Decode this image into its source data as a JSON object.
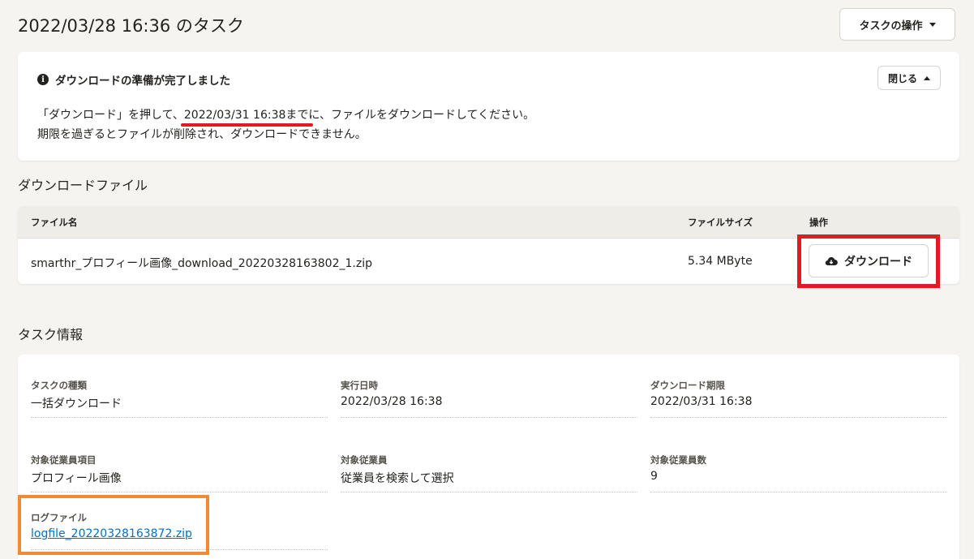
{
  "header": {
    "title": "2022/03/28 16:36 のタスク",
    "actions_label": "タスクの操作"
  },
  "notice": {
    "title": "ダウンロードの準備が完了しました",
    "close_label": "閉じる",
    "line1_prefix": "「ダウンロード」を押して、",
    "line1_deadline": "2022/03/31 16:38まで",
    "line1_suffix": "に、ファイルをダウンロードしてください。",
    "line2": "期限を過ぎるとファイルが削除され、ダウンロードできません。"
  },
  "download_section": {
    "title": "ダウンロードファイル",
    "columns": [
      "ファイル名",
      "ファイルサイズ",
      "操作"
    ],
    "rows": [
      {
        "filename": "smarthr_プロフィール画像_download_20220328163802_1.zip",
        "size": "5.34 MByte",
        "action_label": "ダウンロード"
      }
    ]
  },
  "task_info": {
    "title": "タスク情報",
    "fields": [
      {
        "label": "タスクの種類",
        "value": "一括ダウンロード"
      },
      {
        "label": "実行日時",
        "value": "2022/03/28 16:38"
      },
      {
        "label": "ダウンロード期限",
        "value": "2022/03/31 16:38"
      },
      {
        "label": "対象従業員項目",
        "value": "プロフィール画像"
      },
      {
        "label": "対象従業員",
        "value": "従業員を検索して選択"
      },
      {
        "label": "対象従業員数",
        "value": "9"
      },
      {
        "label": "ログファイル",
        "value": "logfile_20220328163872.zip"
      }
    ]
  },
  "icons": {
    "info": "info-icon",
    "caret": "chevron-down-icon",
    "download": "cloud-download-icon"
  },
  "colors": {
    "highlight_red": "#e01b24",
    "highlight_orange": "#f08b35",
    "link_blue": "#0071c1"
  }
}
